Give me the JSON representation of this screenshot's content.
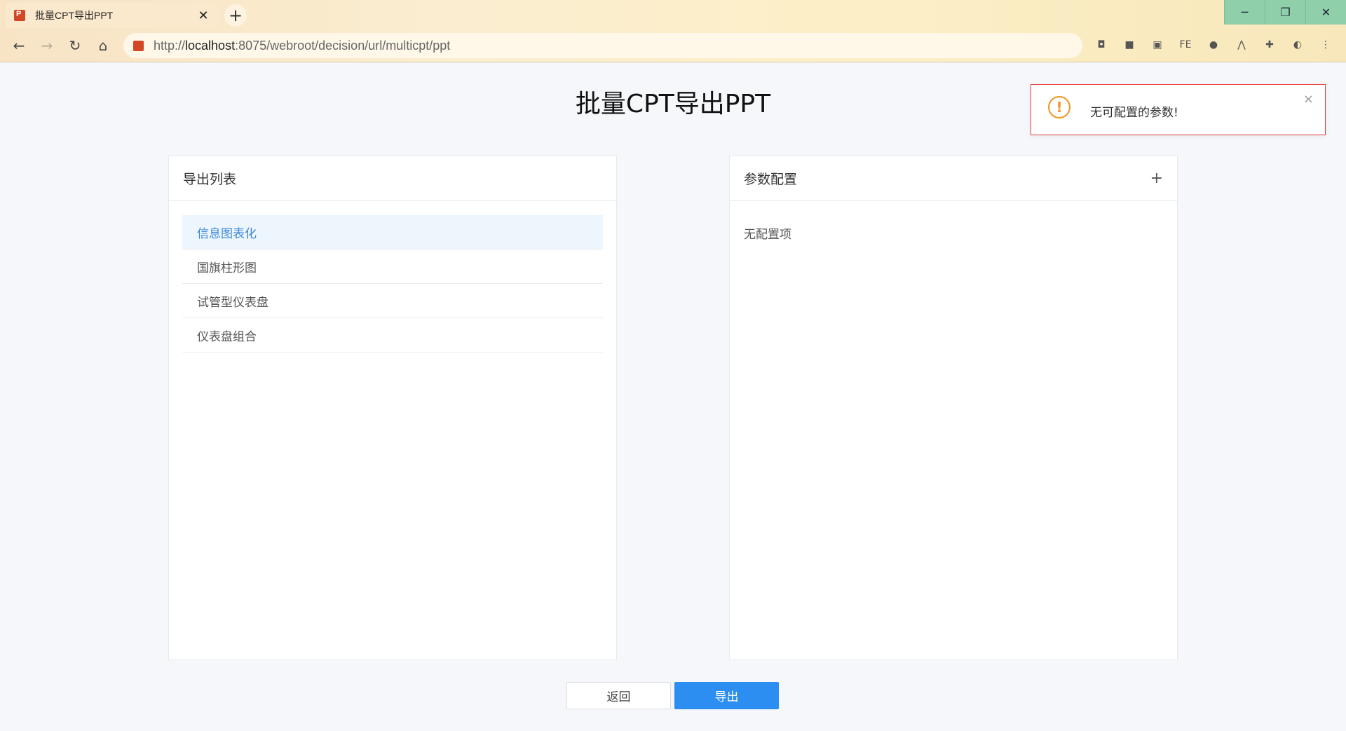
{
  "browser": {
    "tab_title": "批量CPT导出PPT",
    "tab_close": "✕",
    "new_tab": "+",
    "url_prefix": "http://",
    "url_host": "localhost",
    "url_rest": ":8075/webroot/decision/url/multicpt/ppt",
    "window_controls": {
      "minimize": "─",
      "restore": "❐",
      "close": "✕"
    },
    "nav": {
      "back": "←",
      "forward": "→",
      "reload": "↻",
      "home": "⌂"
    },
    "extensions": [
      {
        "name": "gamepad-extension-icon",
        "glyph": "◘"
      },
      {
        "name": "colorful-extension-icon",
        "glyph": "■"
      },
      {
        "name": "image-extension-icon",
        "glyph": "▣"
      },
      {
        "name": "fe-extension-icon",
        "glyph": "FE"
      },
      {
        "name": "opera-extension-icon",
        "glyph": "●"
      },
      {
        "name": "arrow-extension-icon",
        "glyph": "⋀"
      },
      {
        "name": "puzzle-extension-icon",
        "glyph": "✚"
      },
      {
        "name": "profile-avatar-icon",
        "glyph": "◐"
      },
      {
        "name": "menu-kebab-icon",
        "glyph": "⋮"
      }
    ]
  },
  "page": {
    "title": "批量CPT导出PPT",
    "export_list": {
      "header": "导出列表",
      "items": [
        "信息图表化",
        "国旗柱形图",
        "试管型仪表盘",
        "仪表盘组合"
      ],
      "active_index": 0
    },
    "params": {
      "header": "参数配置",
      "add_symbol": "+",
      "empty_text": "无配置项"
    },
    "buttons": {
      "back": "返回",
      "export": "导出"
    },
    "toast": {
      "icon": "!",
      "message": "无可配置的参数!",
      "close": "×"
    }
  },
  "colors": {
    "accent": "#2c8ef0",
    "active_item_text": "#3a86d8",
    "toast_border": "#e53b3b",
    "toast_icon": "#f0961f"
  }
}
